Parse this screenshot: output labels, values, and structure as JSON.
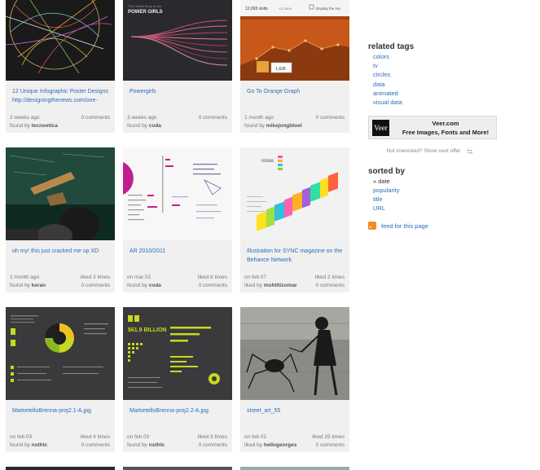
{
  "cards": [
    {
      "title": "12 Unique Infographic Poster Designs",
      "subtitle": "http://designingthenews.com/one-",
      "date": "2 weeks ago",
      "stat": "0 comments",
      "by_label": "found by",
      "user": "tecnoetica",
      "liked": ""
    },
    {
      "title": "Powergirls",
      "subtitle": "",
      "date": "3 weeks ago",
      "stat": "0 comments",
      "by_label": "found by",
      "user": "coda",
      "liked": ""
    },
    {
      "title": "Go To Orange Graph",
      "subtitle": "",
      "date": "1 month ago",
      "stat": "0 comments",
      "by_label": "found by",
      "user": "mikejongbloet",
      "liked": ""
    },
    {
      "title": "oh my! this just cracked me up XD",
      "subtitle": "",
      "date": "1 month ago",
      "liked": "liked 3 times",
      "by_label": "found by",
      "user": "keran",
      "stat": "0 comments"
    },
    {
      "title": "AR 2010/2011",
      "subtitle": "",
      "date": "on mar 02",
      "liked": "liked 8 times",
      "by_label": "found by",
      "user": "coda",
      "stat": "0 comments"
    },
    {
      "title": "Illustration for SYNC magazine on the",
      "subtitle": "Behance Network",
      "date": "on feb 07",
      "liked": "liked 2 times",
      "by_label": "liked by",
      "user": "mohittizomar",
      "stat": "0 comments"
    },
    {
      "title": "MarketelloBrenna-proj2.1-A.jpg",
      "subtitle": "",
      "date": "on feb 03",
      "liked": "liked 4 times",
      "by_label": "found by",
      "user": "nsthtc",
      "stat": "0 comments"
    },
    {
      "title": "MarketelloBrenna-proj2.2-A.jpg",
      "subtitle": "",
      "date": "on feb 03",
      "liked": "liked 3 times",
      "by_label": "found by",
      "user": "nsthtc",
      "stat": "0 comments"
    },
    {
      "title": "street_art_55",
      "subtitle": "",
      "date": "on feb 02",
      "liked": "liked 29 times",
      "by_label": "liked by",
      "user": "hellogeorges",
      "stat": "0 comments"
    }
  ],
  "thumb_text": {
    "powergirls_top": "The Untold Story of the",
    "powergirls": "POWER GIRLS",
    "visits": "12,693 visits",
    "visits_delta": "+12.09%",
    "display": "Display the ma",
    "graph_value": "1,428",
    "ar_billion": "$61.9 BILLION",
    "sync_word": "ronus"
  },
  "sidebar": {
    "related_heading": "related tags",
    "tags": [
      "colors",
      "tv",
      "circles",
      "data",
      "animated",
      "visual data"
    ],
    "ad": {
      "logo": "Veer",
      "line1": "Veer.com",
      "line2": "Free Images, Fonts and More!"
    },
    "not_interested": "Not interested? Show next offer",
    "sorted_heading": "sorted by",
    "sort_current": "» date",
    "sort_options": [
      "popularity",
      "title",
      "URL"
    ],
    "feed_label": "feed for this page"
  },
  "colors": {
    "link": "#2a6fb5",
    "card_bg": "#f0f0f0",
    "orange": "#c8581a",
    "rss": "#f08a24"
  }
}
